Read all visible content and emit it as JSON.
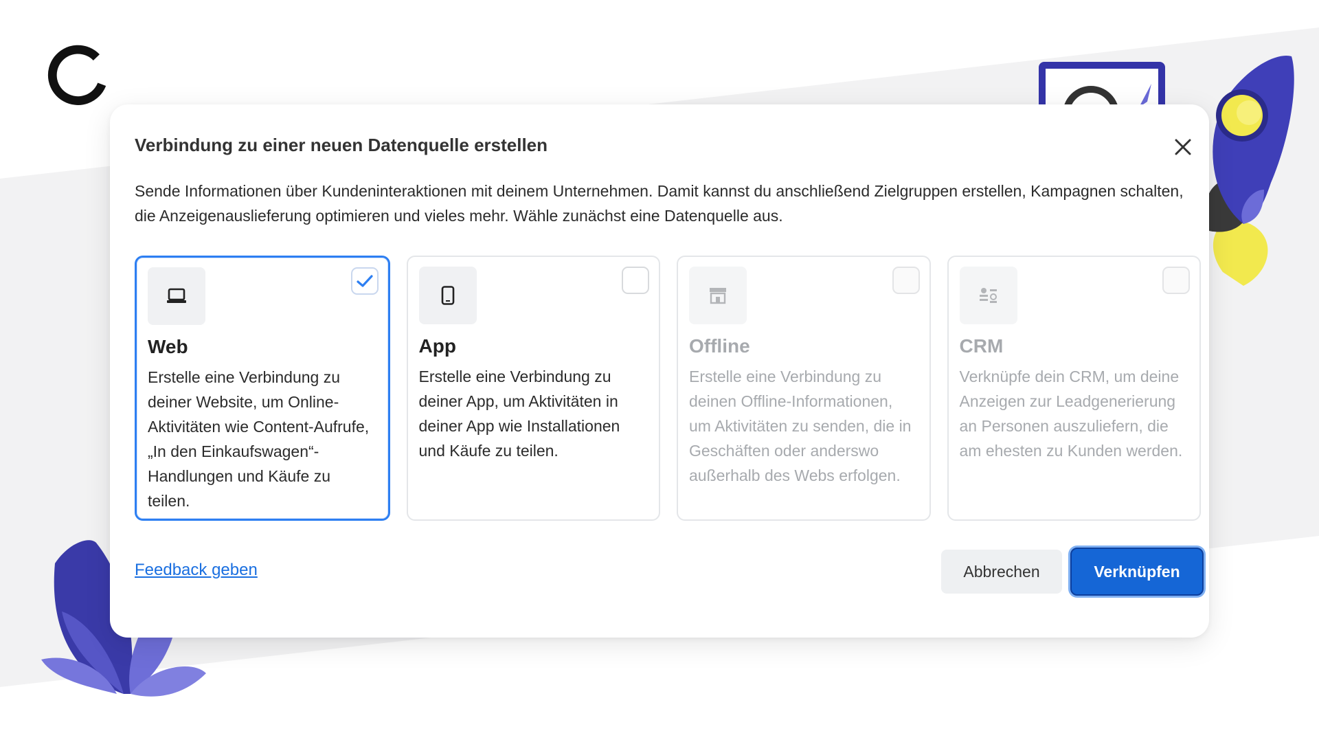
{
  "dialog": {
    "title": "Verbindung zu einer neuen Datenquelle erstellen",
    "description": "Sende Informationen über Kundeninteraktionen mit deinem Unternehmen. Damit kannst du anschließend Zielgruppen erstellen, Kampagnen schalten, die Anzeigenauslieferung optimieren und vieles mehr. Wähle zunächst eine Datenquelle aus.",
    "close_icon": "close-icon"
  },
  "cards": [
    {
      "title": "Web",
      "text": "Erstelle eine Verbindung zu deiner Website, um Online-Aktivitäten wie Content-Aufrufe, „In den Einkaufswagen“-Handlungen und Käufe zu teilen.",
      "icon": "laptop-icon",
      "selected": true,
      "disabled": false
    },
    {
      "title": "App",
      "text": "Erstelle eine Verbindung zu deiner App, um Aktivitäten in deiner App wie Installationen und Käufe zu teilen.",
      "icon": "phone-icon",
      "selected": false,
      "disabled": false
    },
    {
      "title": "Offline",
      "text": "Erstelle eine Verbindung zu deinen Offline-Informationen, um Aktivitäten zu senden, die in Geschäften oder anderswo außerhalb des Webs erfolgen.",
      "icon": "store-icon",
      "selected": false,
      "disabled": true
    },
    {
      "title": "CRM",
      "text": "Verknüpfe dein CRM, um deine Anzeigen zur Leadgenerierung an Personen auszuliefern, die am ehesten zu Kunden werden.",
      "icon": "crm-icon",
      "selected": false,
      "disabled": true
    }
  ],
  "footer": {
    "feedback_link": "Feedback geben",
    "cancel_label": "Abbrechen",
    "connect_label": "Verknüpfen"
  },
  "colors": {
    "accent": "#1566d6",
    "link": "#1a6fe0",
    "selected_border": "#2d7ff2",
    "decor_purple": "#3f3fb8",
    "decor_yellow": "#f2e94e"
  }
}
